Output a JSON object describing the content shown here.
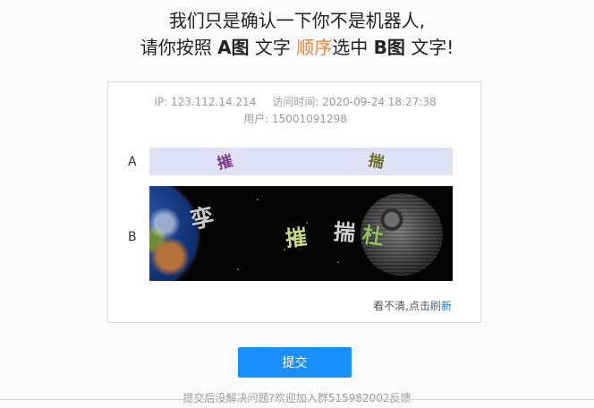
{
  "heading": {
    "line1": "我们只是确认一下你不是机器人,",
    "line2_prefix": "请你按照",
    "line2_a": "A图",
    "line2_mid1": "文字",
    "line2_order": "顺序",
    "line2_mid2": "选中",
    "line2_b": "B图",
    "line2_suffix": "文字!",
    "accent_color": "#e8833a"
  },
  "meta": {
    "ip_label": "IP: 123.112.14.214",
    "time_label": "访问时间: 2020-09-24 18:27:38",
    "user_label": "用户: 15001091298"
  },
  "captcha": {
    "row_a_label": "A",
    "row_b_label": "B",
    "image_a_chars": [
      "摧",
      "揣"
    ],
    "image_b_chars": [
      "孪",
      "摧",
      "揣",
      "杜"
    ],
    "refresh_prefix": "看不清,点击",
    "refresh_link": "刷新"
  },
  "actions": {
    "submit_label": "提交",
    "submit_color": "#1890ff"
  },
  "footer": {
    "help_text": "提交后没解决问题?欢迎加入群515982002反馈"
  }
}
